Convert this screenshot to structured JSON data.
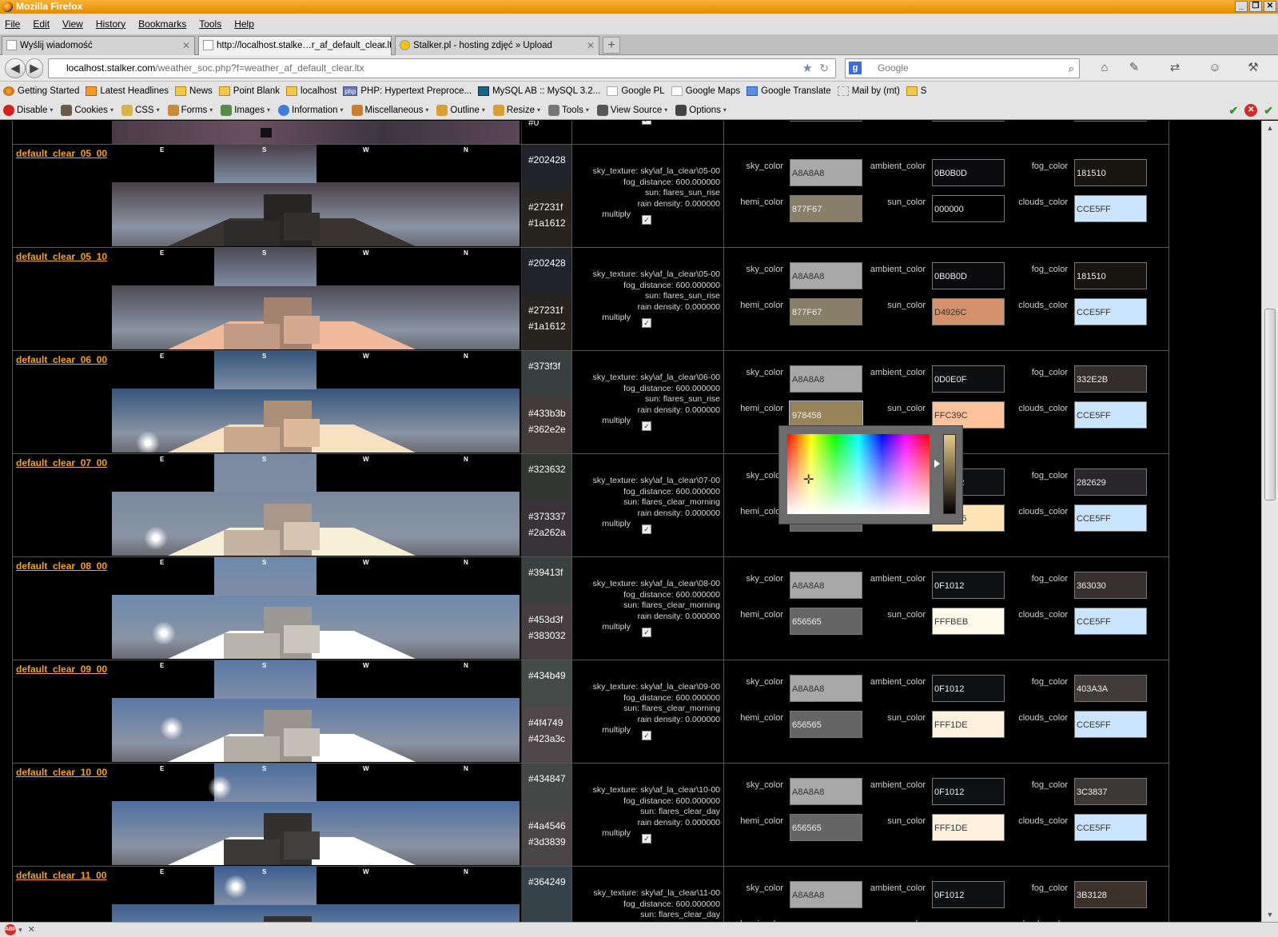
{
  "window": {
    "title": "Mozilla Firefox"
  },
  "menu": [
    "File",
    "Edit",
    "View",
    "History",
    "Bookmarks",
    "Tools",
    "Help"
  ],
  "tabs": [
    {
      "label": "Wyślij wiadomość"
    },
    {
      "label": "http://localhost.stalke…r_af_default_clear.ltx"
    },
    {
      "label": "Stalker.pl - hosting zdjęć » Upload"
    }
  ],
  "nav": {
    "url_host": "localhost.stalker.com",
    "url_path": "/weather_soc.php?f=weather_af_default_clear.ltx",
    "search_placeholder": "Google"
  },
  "bookmarks": [
    "Getting Started",
    "Latest Headlines",
    "News",
    "Point Blank",
    "localhost",
    "PHP: Hypertext Preproce...",
    "MySQL AB :: MySQL 3.2...",
    "Google PL",
    "Google Maps",
    "Google Translate",
    "Mail by (mt)",
    "S"
  ],
  "devtools": [
    "Disable",
    "Cookies",
    "CSS",
    "Forms",
    "Images",
    "Information",
    "Miscellaneous",
    "Outline",
    "Resize",
    "Tools",
    "View Source",
    "Options"
  ],
  "labels": {
    "sky_texture": "sky_texture:",
    "fog_distance": "fog_distance:",
    "sun": "sun:",
    "rain_density": "rain density:",
    "multiply": "multiply",
    "sky_color": "sky_color",
    "ambient_color": "ambient_color",
    "fog_color": "fog_color",
    "hemi_color": "hemi_color",
    "sun_color": "sun_color",
    "clouds_color": "clouds_color"
  },
  "partial_row": {
    "hex": "#0"
  },
  "rows": [
    {
      "name": "default_clear_05_00",
      "hex1": "#202428",
      "hex2": "#27231f",
      "hex3": "#1a1612",
      "sky_texture": "sky\\af_la_clear\\05-00",
      "fog_distance": "600.000000",
      "sun": "flares_sun_rise",
      "rain_density": "0.000000",
      "sky_color": "A8A8A8",
      "ambient_color": "0B0B0D",
      "fog_color": "181510",
      "hemi_color": "877F67",
      "sun_color": "000000",
      "clouds_color": "CCE5FF"
    },
    {
      "name": "default_clear_05_10",
      "hex1": "#202428",
      "hex2": "#27231f",
      "hex3": "#1a1612",
      "sky_texture": "sky\\af_la_clear\\05-00",
      "fog_distance": "600.000000",
      "sun": "flares_sun_rise",
      "rain_density": "0.000000",
      "sky_color": "A8A8A8",
      "ambient_color": "0B0B0D",
      "fog_color": "181510",
      "hemi_color": "877F67",
      "sun_color": "D4926C",
      "clouds_color": "CCE5FF"
    },
    {
      "name": "default_clear_06_00",
      "hex1": "#373f3f",
      "hex2": "#433b3b",
      "hex3": "#362e2e",
      "sky_texture": "sky\\af_la_clear\\06-00",
      "fog_distance": "600.000000",
      "sun": "flares_sun_rise",
      "rain_density": "0.000000",
      "sky_color": "A8A8A8",
      "ambient_color": "0D0E0F",
      "fog_color": "332E2B",
      "hemi_color": "978458",
      "sun_color": "FFC39C",
      "clouds_color": "CCE5FF"
    },
    {
      "name": "default_clear_07_00",
      "hex1": "#323632",
      "hex2": "#373337",
      "hex3": "#2a262a",
      "sky_texture": "sky\\af_la_clear\\07-00",
      "fog_distance": "600.000000",
      "sun": "flares_clear_morning",
      "rain_density": "0.000000",
      "sky_color": "A8A8A8",
      "ambient_color": "0F1012",
      "fog_color": "282629",
      "hemi_color": "656565",
      "sun_color": "FFE5B5",
      "clouds_color": "CCE5FF"
    },
    {
      "name": "default_clear_08_00",
      "hex1": "#39413f",
      "hex2": "#453d3f",
      "hex3": "#383032",
      "sky_texture": "sky\\af_la_clear\\08-00",
      "fog_distance": "600.000000",
      "sun": "flares_clear_morning",
      "rain_density": "0.000000",
      "sky_color": "A8A8A8",
      "ambient_color": "0F1012",
      "fog_color": "363030",
      "hemi_color": "656565",
      "sun_color": "FFFBEB",
      "clouds_color": "CCE5FF"
    },
    {
      "name": "default_clear_09_00",
      "hex1": "#434b49",
      "hex2": "#4f4749",
      "hex3": "#423a3c",
      "sky_texture": "sky\\af_la_clear\\09-00",
      "fog_distance": "600.000000",
      "sun": "flares_clear_morning",
      "rain_density": "0.000000",
      "sky_color": "A8A8A8",
      "ambient_color": "0F1012",
      "fog_color": "403A3A",
      "hemi_color": "656565",
      "sun_color": "FFF1DE",
      "clouds_color": "CCE5FF"
    },
    {
      "name": "default_clear_10_00",
      "hex1": "#434847",
      "hex2": "#4a4546",
      "hex3": "#3d3839",
      "sky_texture": "sky\\af_la_clear\\10-00",
      "fog_distance": "600.000000",
      "sun": "flares_clear_day",
      "rain_density": "0.000000",
      "sky_color": "A8A8A8",
      "ambient_color": "0F1012",
      "fog_color": "3C3837",
      "hemi_color": "656565",
      "sun_color": "FFF1DE",
      "clouds_color": "CCE5FF"
    },
    {
      "name": "default_clear_11_00",
      "hex1": "#364249",
      "hex2": "",
      "hex3": "",
      "sky_texture": "sky\\af_la_clear\\11-00",
      "fog_distance": "600.000000",
      "sun": "flares_clear_day",
      "rain_density": "",
      "sky_color": "A8A8A8",
      "ambient_color": "0F1012",
      "fog_color": "3B3128",
      "hemi_color": "",
      "sun_color": "",
      "clouds_color": ""
    }
  ],
  "pano_sky_colors": [
    "#4a4048",
    "#4d4a55",
    "#35557a",
    "#7a8aa0",
    "#6d89ac",
    "#5a79a6",
    "#4d6fa0",
    "#3c5f90"
  ],
  "pano_floor_colors": [
    "#3a3430",
    "#f0b99a",
    "#f6e2c0",
    "#f8f0d6",
    "#ffffff",
    "#ffffff",
    "#ffffff",
    "#ffffff"
  ],
  "pano_box_colors": [
    "#2e2c2a",
    "#c09a82",
    "#c9a88e",
    "#c4b3a1",
    "#b8b3ac",
    "#b4aea6",
    "#3b3a38",
    "#3b3a38"
  ]
}
